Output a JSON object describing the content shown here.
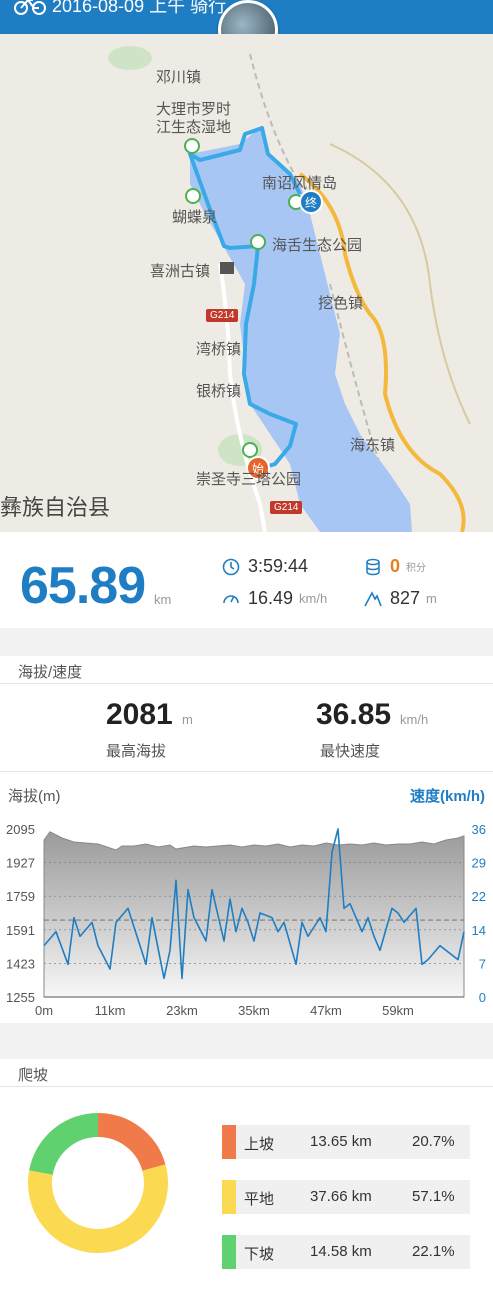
{
  "header": {
    "title": "2016-08-09 上午 骑行",
    "icon": "bike-icon"
  },
  "map": {
    "labels": [
      "邓川镇",
      "大理市罗时",
      "江生态湿地",
      "南诏风情岛",
      "蝴蝶泉",
      "海舌生态公园",
      "喜洲古镇",
      "挖色镇",
      "湾桥镇",
      "银桥镇",
      "海东镇",
      "崇圣寺三塔公园",
      "彝族自治县"
    ],
    "road_tags": [
      "G214",
      "G214"
    ],
    "start_marker": "始",
    "end_marker": "终"
  },
  "summary": {
    "distance": "65.89",
    "distance_unit": "km",
    "duration": "3:59:44",
    "avg_speed": "16.49",
    "avg_speed_unit": "km/h",
    "points": "0",
    "points_unit": "积分",
    "climb": "827",
    "climb_unit": "m"
  },
  "altitude_speed": {
    "section_title": "海拔/速度",
    "max_alt": "2081",
    "max_alt_unit": "m",
    "max_alt_label": "最高海拔",
    "max_speed": "36.85",
    "max_speed_unit": "km/h",
    "max_speed_label": "最快速度"
  },
  "chart_data": {
    "type": "line",
    "left_label": "海拔(m)",
    "right_label": "速度(km/h)",
    "x_ticks": [
      "0m",
      "11km",
      "23km",
      "35km",
      "47km",
      "59km"
    ],
    "x_tick_values": [
      0,
      11,
      23,
      35,
      47,
      59
    ],
    "y_left_ticks": [
      "2095",
      "1927",
      "1759",
      "1591",
      "1423",
      "1255"
    ],
    "y_right_ticks": [
      "36",
      "29",
      "22",
      "14",
      "7",
      "0"
    ],
    "ylim_left": [
      1255,
      2095
    ],
    "ylim_right": [
      0,
      36
    ],
    "xlim": [
      0,
      70
    ],
    "avg_speed_line": 16.49,
    "series": [
      {
        "name": "海拔",
        "x": [
          0,
          1,
          3,
          5,
          7,
          9,
          11,
          12,
          13,
          15,
          17,
          19,
          21,
          22,
          23,
          25,
          27,
          29,
          31,
          33,
          35,
          37,
          39,
          41,
          43,
          45,
          47,
          49,
          51,
          53,
          55,
          57,
          59,
          61,
          63,
          65,
          67,
          69,
          70
        ],
        "values": [
          2040,
          2081,
          2050,
          2030,
          2025,
          2020,
          2000,
          1990,
          2010,
          2010,
          2020,
          2005,
          2015,
          1995,
          2000,
          2010,
          2005,
          2010,
          2015,
          2005,
          2015,
          2010,
          2020,
          2005,
          2015,
          2010,
          2025,
          2015,
          2020,
          2015,
          2025,
          2015,
          2020,
          2020,
          2030,
          2020,
          2040,
          2050,
          2060
        ]
      },
      {
        "name": "速度",
        "x": [
          0,
          2,
          4,
          5,
          6,
          8,
          9,
          11,
          12,
          14,
          15,
          17,
          18,
          20,
          21,
          22,
          23,
          24,
          25,
          27,
          28,
          30,
          31,
          32,
          33,
          34,
          35,
          36,
          38,
          39,
          40,
          42,
          43,
          44,
          45,
          46,
          47,
          48,
          49,
          50,
          51,
          53,
          54,
          55,
          56,
          58,
          59,
          60,
          62,
          63,
          64,
          66,
          67,
          69,
          70
        ],
        "values": [
          11,
          14,
          7,
          17,
          13,
          16,
          11,
          6,
          16,
          19,
          15,
          7,
          17,
          4,
          10,
          25,
          4,
          23,
          17,
          12,
          23,
          12,
          21,
          14,
          19,
          16,
          12,
          18,
          17,
          14,
          16,
          7,
          16,
          13,
          15,
          17,
          14,
          31,
          36,
          19,
          20,
          14,
          17,
          13,
          10,
          19,
          18,
          16,
          19,
          7,
          8,
          11,
          10,
          8,
          14
        ]
      }
    ]
  },
  "climb": {
    "section_title": "爬坡",
    "items": [
      {
        "name": "上坡",
        "distance": "13.65 km",
        "percent": "20.7%",
        "value": 20.7,
        "color": "#f07a4a"
      },
      {
        "name": "平地",
        "distance": "37.66 km",
        "percent": "57.1%",
        "value": 57.1,
        "color": "#fbd951"
      },
      {
        "name": "下坡",
        "distance": "14.58 km",
        "percent": "22.1%",
        "value": 22.1,
        "color": "#5fd16f"
      }
    ]
  },
  "colors": {
    "accent": "#1f7ec3",
    "lake": "#a8c6f4",
    "route": "#3aa9e8"
  }
}
